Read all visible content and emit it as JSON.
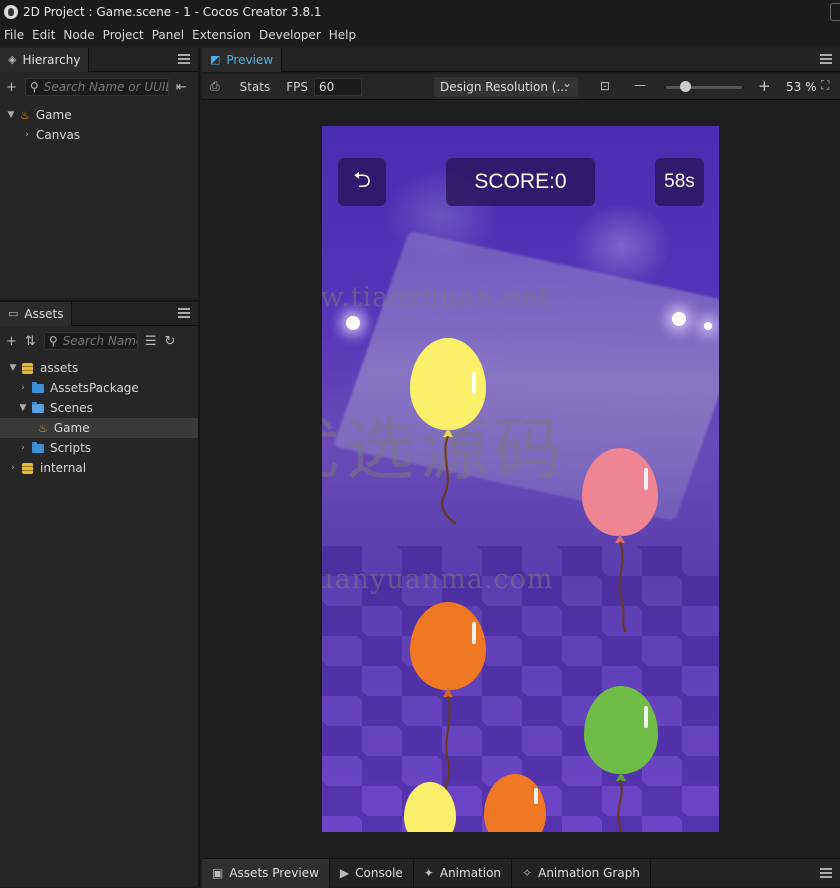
{
  "window": {
    "title": "2D Project : Game.scene - 1 - Cocos Creator 3.8.1"
  },
  "menu": [
    "File",
    "Edit",
    "Node",
    "Project",
    "Panel",
    "Extension",
    "Developer",
    "Help"
  ],
  "hierarchy": {
    "tab": "Hierarchy",
    "search_placeholder": "Search Name or UUID",
    "items": [
      {
        "label": "Game"
      },
      {
        "label": "Canvas"
      }
    ]
  },
  "assets": {
    "tab": "Assets",
    "search_placeholder": "Search Name",
    "items": [
      {
        "label": "assets"
      },
      {
        "label": "AssetsPackage"
      },
      {
        "label": "Scenes"
      },
      {
        "label": "Game"
      },
      {
        "label": "Scripts"
      },
      {
        "label": "internal"
      }
    ]
  },
  "preview": {
    "tab": "Preview",
    "stats_label": "Stats",
    "fps_label": "FPS",
    "fps_value": "60",
    "design_resolution": "Design Resolution (...",
    "zoom_minus": "—",
    "zoom_plus": "+",
    "zoom_value": "53 %",
    "zoom_level": 0.25
  },
  "game": {
    "back_icon": "back-arrow-icon",
    "score": "SCORE:0",
    "timer": "58s",
    "watermark_1": "www.tiaozhuan.net",
    "watermark_2": "优选源码",
    "watermark_3": "u.xuanyuanma.com",
    "balloon_colors": {
      "yellow": "#fbf06a",
      "pink": "#ef8593",
      "orange": "#f07723",
      "green": "#6fbd47"
    }
  },
  "bottom_tabs": [
    "Assets Preview",
    "Console",
    "Animation",
    "Animation Graph"
  ]
}
